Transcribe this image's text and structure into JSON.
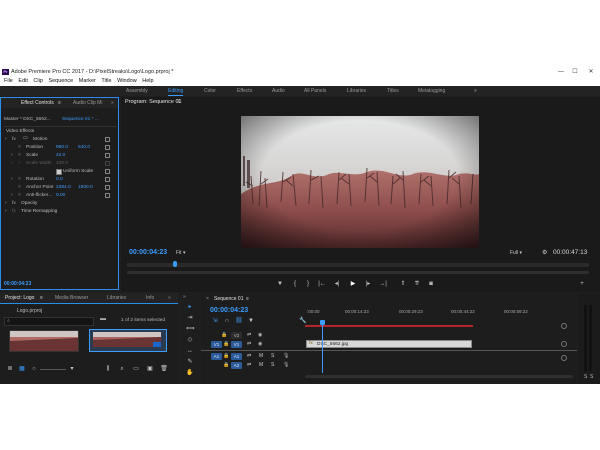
{
  "app": {
    "title": "Adobe Premiere Pro CC 2017 - D:\\PixelStreaks\\Logo\\Logo.prproj *",
    "menu": [
      "File",
      "Edit",
      "Clip",
      "Sequence",
      "Marker",
      "Title",
      "Window",
      "Help"
    ],
    "workspaces": [
      "Assembly",
      "Editing",
      "Color",
      "Effects",
      "Audio",
      "All Panels",
      "Libraries",
      "Titles",
      "Metalogging"
    ],
    "active_workspace": "Editing",
    "window_buttons": {
      "min": "—",
      "max": "☐",
      "close": "✕"
    }
  },
  "effect_controls": {
    "tabs": [
      "Effect Controls",
      "Audio Clip Mi"
    ],
    "master": "Master * DSC_5662...",
    "sequence": "Sequence 01 * ...",
    "section": "Video Effects",
    "motion": "Motion",
    "params": [
      {
        "name": "Position",
        "v1": "960.0",
        "v2": "540.0"
      },
      {
        "name": "Scale",
        "v1": "42.0",
        "v2": ""
      },
      {
        "name": "Scale Width",
        "v1": "100.0",
        "v2": ""
      },
      {
        "name": "Uniform Scale",
        "v1": "",
        "v2": ""
      },
      {
        "name": "Rotation",
        "v1": "0.0",
        "v2": ""
      },
      {
        "name": "Anchor Point",
        "v1": "2384.0",
        "v2": "1500.0"
      },
      {
        "name": "Anti-flicker...",
        "v1": "0.00",
        "v2": ""
      }
    ],
    "opacity": "Opacity",
    "time_remapping": "Time Remapping",
    "timecode": "00:00:04:23"
  },
  "program": {
    "title": "Program: Sequence 01",
    "timecode": "00:00:04:23",
    "fit": "Fit",
    "quality": "Full",
    "duration": "00:00:47:13"
  },
  "project": {
    "tabs": [
      "Project: Logo",
      "Media Browser",
      "Libraries",
      "Info"
    ],
    "file": "Logo.prproj",
    "selection": "1 of 2 items selected"
  },
  "timeline": {
    "title": "Sequence 01",
    "timecode": "00:00:04:23",
    "ruler": [
      ":00:00",
      "00:00:14:23",
      "00:00:29:23",
      "00:00:44:22",
      "00:00:59:22"
    ],
    "tracks": {
      "v2": "V2",
      "v1": "V1",
      "a1": "A1",
      "a2": "A2"
    },
    "clip": "DSC_5662.jpg",
    "mute": "M",
    "solo": "S"
  },
  "colors": {
    "accent": "#3b9dff",
    "clip": "#d8d8d8",
    "panel": "#1d1d1d"
  }
}
